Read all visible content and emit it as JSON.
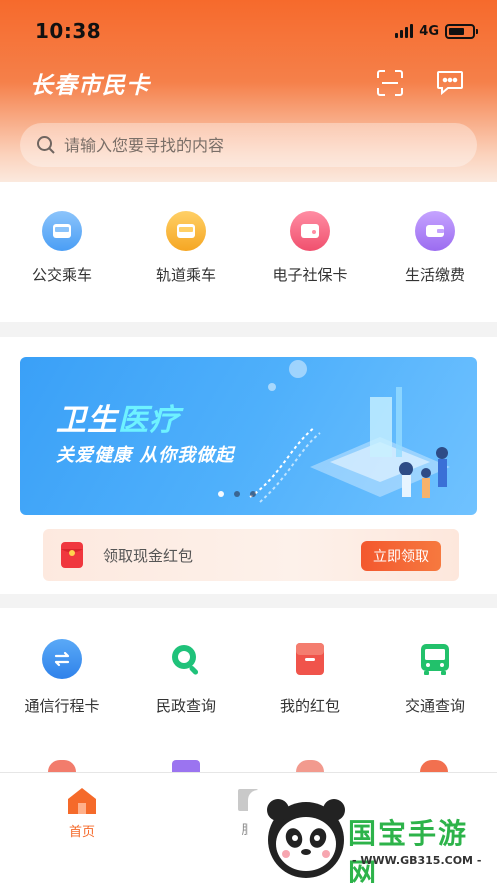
{
  "status_bar": {
    "time": "10:38",
    "network": "4G",
    "battery_level": 0.7
  },
  "header": {
    "title": "长春市民卡"
  },
  "search": {
    "placeholder": "请输入您要寻找的内容"
  },
  "quick_actions": [
    {
      "label": "公交乘车",
      "icon": "bus-card-icon",
      "color": "#4a9ef5"
    },
    {
      "label": "轨道乘车",
      "icon": "metro-card-icon",
      "color": "#f5a623"
    },
    {
      "label": "电子社保卡",
      "icon": "social-security-card-icon",
      "color": "#f0506e"
    },
    {
      "label": "生活缴费",
      "icon": "wallet-icon",
      "color": "#9b6cf0"
    }
  ],
  "banner": {
    "title_part1": "卫生",
    "title_part2": "医疗",
    "subtitle": "关爱健康 从你我做起",
    "slide_index": 1,
    "slide_count": 3
  },
  "red_packet": {
    "label": "领取现金红包",
    "button": "立即领取"
  },
  "services": [
    {
      "label": "通信行程卡",
      "icon": "travel-card-icon",
      "color": "#3b8ef0"
    },
    {
      "label": "民政查询",
      "icon": "search-query-icon",
      "color": "#1fc27a"
    },
    {
      "label": "我的红包",
      "icon": "red-packet-icon",
      "color": "#f0544b"
    },
    {
      "label": "交通查询",
      "icon": "bus-icon",
      "color": "#22c16b"
    }
  ],
  "tabs": [
    {
      "label": "首页",
      "icon": "home-icon",
      "active": true
    },
    {
      "label": "服",
      "icon": "service-icon",
      "active": false
    }
  ],
  "watermark": {
    "brand": "国宝手游网",
    "url": "- WWW.GB315.COM -"
  },
  "colors": {
    "primary": "#f66a2c",
    "active_tab": "#f56a2a"
  }
}
